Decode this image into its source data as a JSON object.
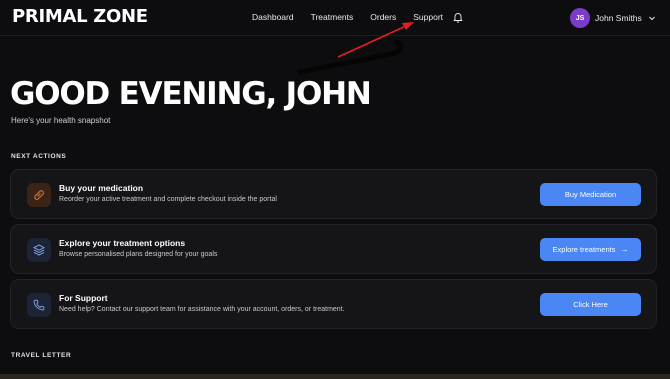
{
  "header": {
    "logo": "PRIMAL ZONE",
    "nav": [
      "Dashboard",
      "Treatments",
      "Orders",
      "Support"
    ],
    "user": {
      "initials": "JS",
      "name": "John Smiths"
    },
    "icons": {
      "notifications": "bell-icon",
      "user_menu": "chevron-down-icon"
    }
  },
  "hero": {
    "greeting": "GOOD EVENING, JOHN",
    "subtitle": "Here's your health snapshot"
  },
  "sections": {
    "next_actions": "NEXT ACTIONS",
    "travel_letter": "TRAVEL LETTER"
  },
  "cards": [
    {
      "title": "Buy your medication",
      "description": "Reorder your active treatment and complete checkout inside the portal",
      "button": "Buy Medication",
      "icon": "pill-icon",
      "icon_color": "#c5713a",
      "icon_bg": "#3a2418"
    },
    {
      "title": "Explore your treatment options",
      "description": "Browse personalised plans designed for your goals",
      "button": "Explore treatments",
      "button_icon": "→",
      "icon": "layers-icon",
      "icon_color": "#7f9bd6",
      "icon_bg": "#1c2436"
    },
    {
      "title": "For Support",
      "description": "Need help? Contact our support team for assistance with your account, orders, or treatment.",
      "button": "Click Here",
      "icon": "phone-icon",
      "icon_color": "#7f9bd6",
      "icon_bg": "#1c2436"
    }
  ],
  "colors": {
    "background": "#0d0d0f",
    "card": "#151518",
    "accent": "#4a86f4",
    "avatar": "#7a3cc9",
    "annotation": "#e02020"
  }
}
